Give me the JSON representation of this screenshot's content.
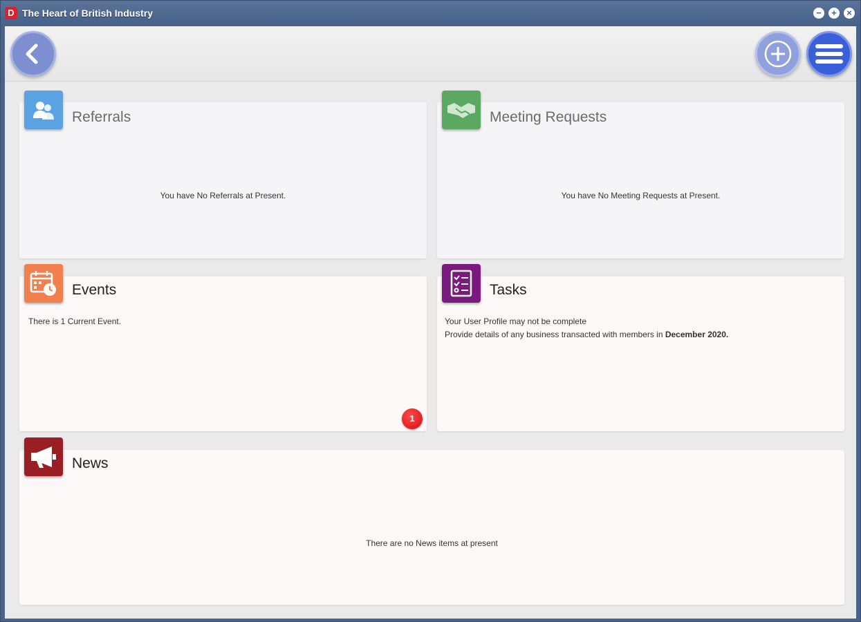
{
  "window": {
    "title": "The Heart of British Industry",
    "logo_letter": "D",
    "controls": {
      "minimize": "−",
      "maximize": "+",
      "close": "×"
    }
  },
  "toolbar": {
    "back_icon": "chevron-left-icon",
    "add_icon": "plus-icon",
    "menu_icon": "hamburger-menu-icon"
  },
  "cards": {
    "referrals": {
      "title": "Referrals",
      "message": "You have No Referrals at Present.",
      "icon": "people-icon",
      "color": "#5aa2e2"
    },
    "meetings": {
      "title": "Meeting Requests",
      "message": "You have No Meeting Requests at Present.",
      "icon": "handshake-icon",
      "color": "#5aa862"
    },
    "events": {
      "title": "Events",
      "message": "There is 1 Current Event.",
      "badge": "1",
      "icon": "calendar-clock-icon",
      "color": "#f2804f"
    },
    "tasks": {
      "title": "Tasks",
      "line1": "Your User Profile may not be complete",
      "line2_prefix": "Provide details of any business transacted with members in ",
      "line2_bold": "December 2020.",
      "icon": "checklist-icon",
      "color": "#7b1a7e"
    },
    "news": {
      "title": "News",
      "message": "There are no News items at present",
      "icon": "megaphone-icon",
      "color": "#9a1f24"
    }
  }
}
